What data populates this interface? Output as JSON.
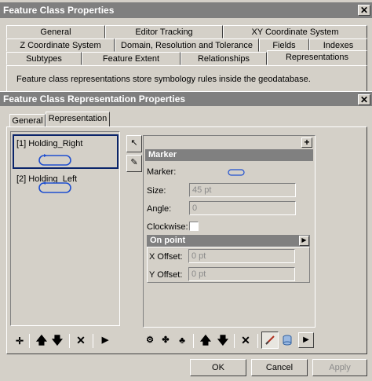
{
  "outer_dialog": {
    "title": "Feature Class Properties",
    "tabs_row1": [
      "General",
      "Editor Tracking",
      "XY Coordinate System"
    ],
    "tabs_row2": [
      "Z Coordinate System",
      "Domain, Resolution and Tolerance",
      "Fields",
      "Indexes"
    ],
    "tabs_row3": [
      "Subtypes",
      "Feature Extent",
      "Relationships",
      "Representations"
    ],
    "active_tab": "Representations",
    "description": "Feature class representations store symbology rules inside the geodatabase."
  },
  "inner_dialog": {
    "title": "Feature Class Representation Properties",
    "tabs": [
      "General",
      "Representation"
    ],
    "active_tab": "Representation",
    "rules": [
      {
        "label": "[1] Holding_Right",
        "selected": true
      },
      {
        "label": "[2] Holding_Left",
        "selected": false
      }
    ],
    "marker_section": {
      "header": "Marker",
      "marker_label": "Marker:",
      "size_label": "Size:",
      "size_value": "45 pt",
      "angle_label": "Angle:",
      "angle_value": "0",
      "clockwise_label": "Clockwise:",
      "clockwise_checked": false
    },
    "on_point_section": {
      "header": "On point",
      "x_offset_label": "X Offset:",
      "x_offset_value": "0 pt",
      "y_offset_label": "Y Offset:",
      "y_offset_value": "0 pt"
    },
    "buttons": {
      "ok": "OK",
      "cancel": "Cancel",
      "apply": "Apply"
    }
  },
  "colors": {
    "face": "#d4d0c8",
    "titlebar": "#7f7f7f",
    "selection_border": "#0a246a",
    "marker_blue": "#1f4fd0"
  }
}
